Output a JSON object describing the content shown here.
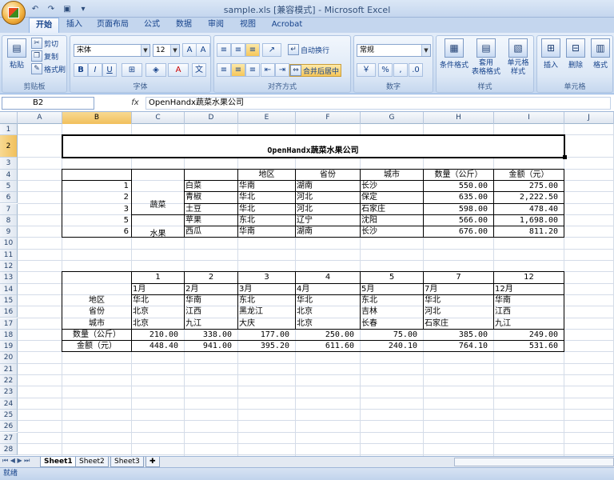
{
  "window": {
    "title": "sample.xls  [兼容模式] - Microsoft Excel"
  },
  "qat": {
    "save_icon": "save-icon",
    "undo_icon": "undo-icon",
    "redo_icon": "redo-icon",
    "customize": "▾"
  },
  "tabs": [
    "开始",
    "插入",
    "页面布局",
    "公式",
    "数据",
    "审阅",
    "视图",
    "Acrobat"
  ],
  "ribbon": {
    "clipboard": {
      "label": "剪贴板",
      "paste": "粘贴",
      "cut": "剪切",
      "copy": "复制",
      "format_painter": "格式刷"
    },
    "font": {
      "label": "字体",
      "name": "宋体",
      "size": "12",
      "bold": "B",
      "italic": "I",
      "underline": "U"
    },
    "alignment": {
      "label": "对齐方式",
      "wrap": "自动换行",
      "merge": "合并后居中"
    },
    "number": {
      "label": "数字",
      "format": "常规",
      "percent": "%",
      "comma": ","
    },
    "styles": {
      "label": "样式",
      "conditional": "条件格式",
      "table": "套用\n表格格式",
      "cell_styles": "单元格\n样式"
    },
    "cells": {
      "label": "单元格",
      "insert": "插入",
      "delete": "删除",
      "format": "格式"
    }
  },
  "formula_bar": {
    "cell_ref": "B2",
    "fx": "fx",
    "content": "OpenHandx蔬菜水果公司"
  },
  "columns": [
    "A",
    "B",
    "C",
    "D",
    "E",
    "F",
    "G",
    "H",
    "I",
    "J"
  ],
  "rows": [
    "1",
    "2",
    "3",
    "4",
    "5",
    "6",
    "7",
    "8",
    "9",
    "10",
    "11",
    "12",
    "13",
    "14",
    "15",
    "16",
    "17",
    "18",
    "19",
    "20",
    "21",
    "22",
    "23",
    "24",
    "25",
    "26",
    "27",
    "28"
  ],
  "table1": {
    "title": "OpenHandx蔬菜水果公司",
    "headers": [
      "地区",
      "省份",
      "城市",
      "数量（公斤）",
      "金额（元）"
    ],
    "groups": [
      "蔬菜",
      "水果"
    ],
    "rows": [
      {
        "no": "1",
        "item": "白菜",
        "region": "华南",
        "province": "湖南",
        "city": "长沙",
        "qty": "550.00",
        "amount": "275.00"
      },
      {
        "no": "2",
        "item": "青椒",
        "region": "华北",
        "province": "河北",
        "city": "保定",
        "qty": "635.00",
        "amount": "2,222.50"
      },
      {
        "no": "3",
        "item": "土豆",
        "region": "华北",
        "province": "河北",
        "city": "石家庄",
        "qty": "598.00",
        "amount": "478.40"
      },
      {
        "no": "5",
        "item": "苹果",
        "region": "东北",
        "province": "辽宁",
        "city": "沈阳",
        "qty": "566.00",
        "amount": "1,698.00"
      },
      {
        "no": "6",
        "item": "西瓜",
        "region": "华南",
        "province": "湖南",
        "city": "长沙",
        "qty": "676.00",
        "amount": "811.20"
      }
    ]
  },
  "table2": {
    "numbers": [
      "1",
      "2",
      "3",
      "4",
      "5",
      "7",
      "12"
    ],
    "months": [
      "1月",
      "2月",
      "3月",
      "4月",
      "5月",
      "7月",
      "12月"
    ],
    "row_labels": [
      "地区",
      "省份",
      "城市",
      "数量（公斤）",
      "金额（元）"
    ],
    "region": [
      "华北",
      "华南",
      "东北",
      "华北",
      "东北",
      "华北",
      "华南"
    ],
    "province": [
      "北京",
      "江西",
      "黑龙江",
      "北京",
      "吉林",
      "河北",
      "江西"
    ],
    "city": [
      "北京",
      "九江",
      "大庆",
      "北京",
      "长春",
      "石家庄",
      "九江"
    ],
    "qty": [
      "210.00",
      "338.00",
      "177.00",
      "250.00",
      "75.00",
      "385.00",
      "249.00"
    ],
    "amount": [
      "448.40",
      "941.00",
      "395.20",
      "611.60",
      "240.10",
      "764.10",
      "531.60"
    ]
  },
  "sheet_tabs": [
    "Sheet1",
    "Sheet2",
    "Sheet3"
  ],
  "status": {
    "text": "就绪"
  }
}
